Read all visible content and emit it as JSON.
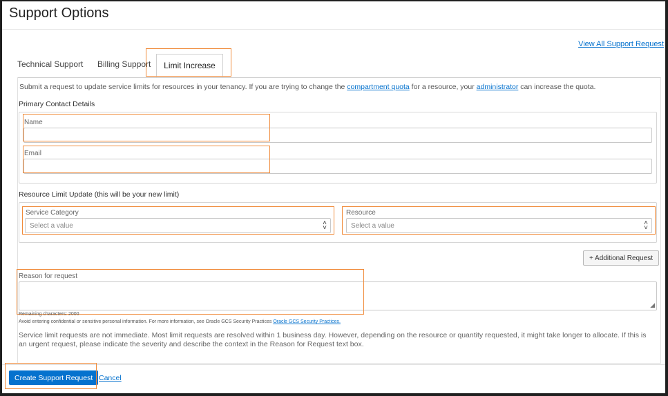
{
  "page": {
    "title": "Support Options",
    "view_all_link": "View All Support Request"
  },
  "tabs": [
    {
      "label": "Technical Support"
    },
    {
      "label": "Billing Support"
    },
    {
      "label": "Limit Increase",
      "active": true
    }
  ],
  "intro": {
    "prefix": "Submit a request to update service limits for resources in your tenancy. If you are trying to change the ",
    "link1": "compartment quota",
    "middle": " for a resource, your ",
    "link2": "administrator",
    "suffix": " can increase the quota."
  },
  "primary_contact": {
    "heading": "Primary Contact Details",
    "name_label": "Name",
    "name_value": "",
    "email_label": "Email",
    "email_value": ""
  },
  "resource_limit": {
    "heading": "Resource Limit Update (this will be your new limit)",
    "service_category_label": "Service Category",
    "service_category_placeholder": "Select a value",
    "resource_label": "Resource",
    "resource_placeholder": "Select a value",
    "add_button": "+ Additional Request"
  },
  "reason": {
    "label": "Reason for request",
    "remaining": "Remaining characters: 2000",
    "privacy_prefix": "Avoid entering confidential or sensitive personal information. For more information, see Oracle GCS Security Practices",
    "privacy_link": "Oracle GCS Security Practices."
  },
  "notice": "Service limit requests are not immediate. Most limit requests are resolved within 1 business day. However, depending on the resource or quantity requested, it might take longer to allocate. If this is an urgent request, please indicate the severity and describe the context in the Reason for Request text box.",
  "footer": {
    "submit": "Create Support Request",
    "cancel": "Cancel"
  },
  "colors": {
    "accent": "#0572ce",
    "highlight": "#f08b3a"
  }
}
